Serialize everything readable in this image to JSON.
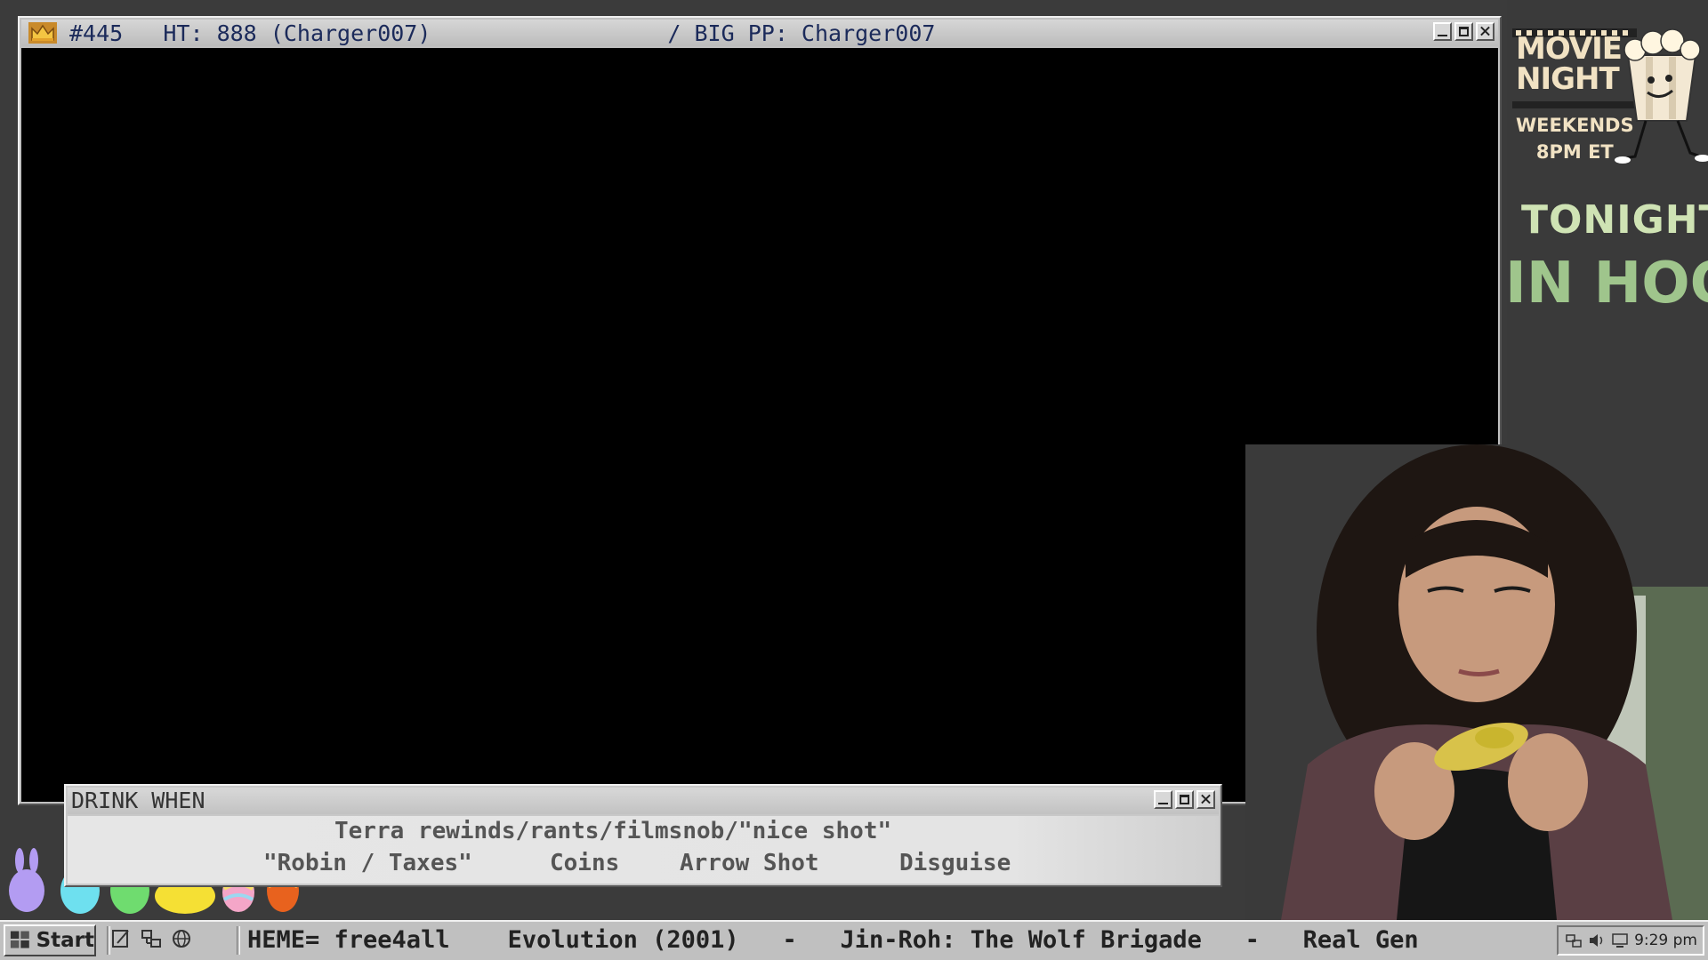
{
  "main_window": {
    "title_number": "#445",
    "title_ht": "HT: 888 (Charger007)",
    "title_big_pp": "/ BIG PP: Charger007",
    "icon": "crown-icon"
  },
  "drink_when": {
    "title": "DRINK WHEN",
    "line1": "Terra rewinds/rants/filmsnob/\"nice shot\"",
    "items": [
      "\"Robin / Taxes\"",
      "Coins",
      "Arrow Shot",
      "Disguise"
    ]
  },
  "side_panel": {
    "movie_line1": "MOVIE",
    "movie_line2": "NIGHT",
    "schedule_line1": "WEEKENDS",
    "schedule_line2": "8PM ET",
    "tonight_label": "TONIGHT:",
    "tonight_title": "IN HOOD"
  },
  "taskbar": {
    "start_label": "Start",
    "marquee": "HEME= free4all    Evolution (2001)   -   Jin-Roh: The Wolf Brigade   -   Real Gen",
    "clock": "9:29 pm"
  },
  "colors": {
    "window_grey": "#c0c0c0",
    "title_text": "#1b2a5a",
    "tonight_green": "#9fc58c"
  }
}
